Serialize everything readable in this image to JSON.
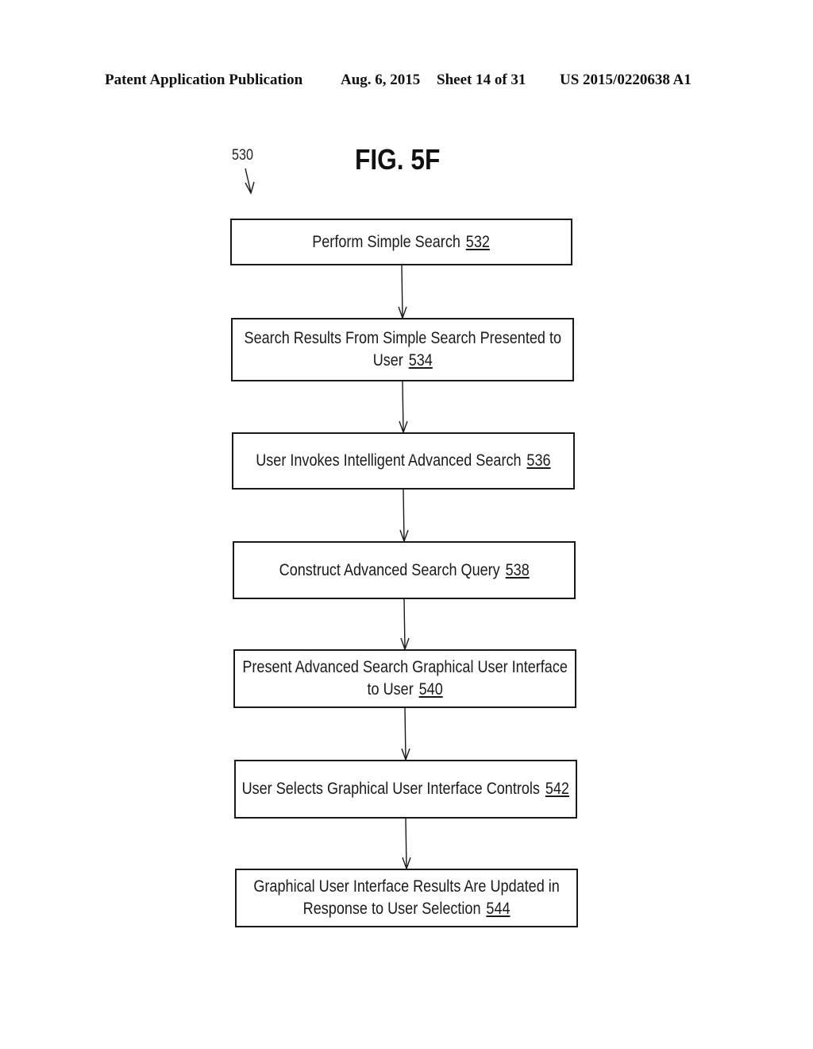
{
  "header": {
    "publication_label": "Patent Application Publication",
    "date": "Aug. 6, 2015",
    "sheet": "Sheet 14 of 31",
    "patent_number": "US 2015/0220638 A1"
  },
  "figure": {
    "title": "FIG. 5F",
    "reference_numeral": "530"
  },
  "flowchart": {
    "steps": [
      {
        "lines": [
          "Perform Simple Search"
        ],
        "number": "532"
      },
      {
        "lines": [
          "Search Results From Simple Search Presented to",
          "User"
        ],
        "number": "534"
      },
      {
        "lines": [
          "User Invokes Intelligent Advanced Search"
        ],
        "number": "536"
      },
      {
        "lines": [
          "Construct Advanced Search Query"
        ],
        "number": "538"
      },
      {
        "lines": [
          "Present Advanced Search Graphical User Interface",
          "to User"
        ],
        "number": "540"
      },
      {
        "lines": [
          "User Selects Graphical User Interface Controls"
        ],
        "number": "542"
      },
      {
        "lines": [
          "Graphical User Interface Results Are Updated in",
          "Response to User Selection"
        ],
        "number": "544"
      }
    ]
  }
}
